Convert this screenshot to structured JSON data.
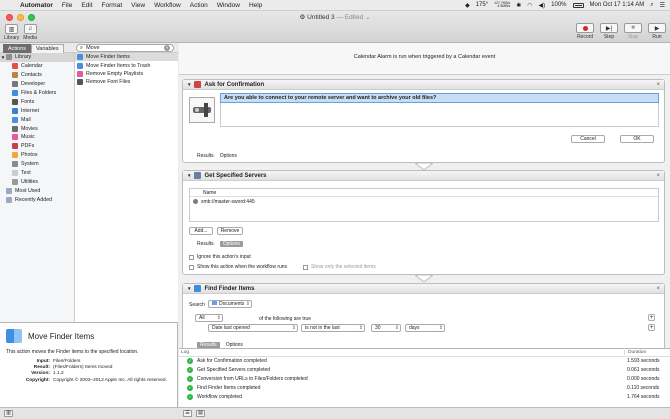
{
  "menubar": {
    "app_name": "Automator",
    "items": [
      "File",
      "Edit",
      "Format",
      "View",
      "Workflow",
      "Action",
      "Window",
      "Help"
    ],
    "temperature": "175°",
    "net_up": "127.7KB/s",
    "net_down": "4.5MB/s",
    "battery": "100%",
    "datetime": "Mon Oct 17  1:14 AM"
  },
  "window": {
    "title": "Untitled 3",
    "edited": "— Edited ⌄"
  },
  "toolbar": {
    "library_label": "Library",
    "media_label": "Media",
    "record_label": "Record",
    "step_label": "Step",
    "stop_label": "Stop",
    "run_label": "Run"
  },
  "library_pane": {
    "tab_actions": "Actions",
    "tab_variables": "Variables",
    "search_value": "Move",
    "root_label": "Library",
    "categories": [
      {
        "label": "Calendar",
        "color": "#e94f3b"
      },
      {
        "label": "Contacts",
        "color": "#b8864b"
      },
      {
        "label": "Developer",
        "color": "#777777"
      },
      {
        "label": "Files & Folders",
        "color": "#3e8ede"
      },
      {
        "label": "Fonts",
        "color": "#555555"
      },
      {
        "label": "Internet",
        "color": "#3b7fd1"
      },
      {
        "label": "Mail",
        "color": "#4a90e2"
      },
      {
        "label": "Movies",
        "color": "#6b6b6b"
      },
      {
        "label": "Music",
        "color": "#e85aa0"
      },
      {
        "label": "PDFs",
        "color": "#c94141"
      },
      {
        "label": "Photos",
        "color": "#f2a73b"
      },
      {
        "label": "System",
        "color": "#8a8a8a"
      },
      {
        "label": "Text",
        "color": "#cccccc"
      },
      {
        "label": "Utilities",
        "color": "#9a9a9a"
      }
    ],
    "most_used": "Most Used",
    "recently_added": "Recently Added",
    "actions": [
      "Move Finder Items",
      "Move Finder Items to Trash",
      "Remove Empty Playlists",
      "Remove Font Files"
    ]
  },
  "description": {
    "title": "Move Finder Items",
    "text": "This action moves the Finder items to the specified location.",
    "input_key": "Input:",
    "input_val": "Files/Folders",
    "result_key": "Result:",
    "result_val": "(Files/Folders) Items moved",
    "version_key": "Version:",
    "version_val": "1.1.2",
    "copyright_key": "Copyright:",
    "copyright_val": "Copyright © 2003–2012 Apple Inc.  All rights reserved."
  },
  "workflow": {
    "banner": "Calendar Alarm is run when triggered by a Calendar event",
    "confirm": {
      "title": "Ask for Confirmation",
      "message": "Are you able to connect to your remote server and want to archive your old files?",
      "cancel": "Cancel",
      "ok": "OK",
      "results": "Results",
      "options": "Options"
    },
    "servers": {
      "title": "Get Specified Servers",
      "col_name": "Name",
      "server": "smb://master-sword:445",
      "add": "Add...",
      "remove": "Remove",
      "results": "Results",
      "options": "Options",
      "ignore_input": "Ignore this action's input",
      "show_when_run": "Show this action when the workflow runs",
      "show_selected": "Show only the selected items"
    },
    "find": {
      "title": "Find Finder Items",
      "search_label": "Search",
      "search_location": "Documents",
      "match": "All",
      "match_suffix": "of the following are true",
      "criterion": "Date last opened",
      "operator": "is not in the last",
      "amount": "30",
      "unit": "days",
      "results": "Results",
      "options": "Options"
    }
  },
  "log": {
    "col_log": "Log",
    "col_duration": "Duration",
    "rows": [
      {
        "message": "Ask for Confirmation completed",
        "duration": "1.593 seconds"
      },
      {
        "message": "Get Specified Servers completed",
        "duration": "0.061 seconds"
      },
      {
        "message": "Conversion from URLs to Files/Folders completed",
        "duration": "0.000 seconds"
      },
      {
        "message": "Find Finder Items completed",
        "duration": "0.110 seconds"
      },
      {
        "message": "Workflow completed",
        "duration": "1.764 seconds"
      }
    ]
  }
}
